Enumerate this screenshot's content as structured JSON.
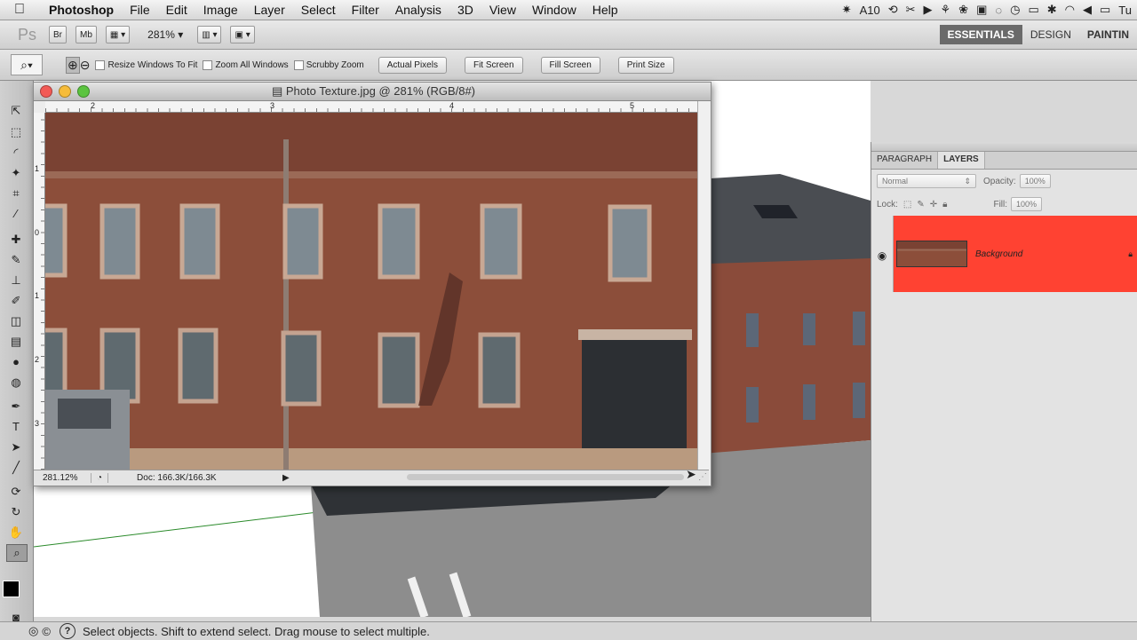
{
  "menubar": {
    "app_name": "Photoshop",
    "items": [
      "File",
      "Edit",
      "Image",
      "Layer",
      "Select",
      "Filter",
      "Analysis",
      "3D",
      "View",
      "Window",
      "Help"
    ],
    "tray_text": "10",
    "tray_end": "Tu"
  },
  "appbar": {
    "logo": "Ps",
    "bridge": "Br",
    "minibridge": "Mb",
    "zoom": "281%",
    "workspaces": [
      "ESSENTIALS",
      "DESIGN",
      "PAINTIN"
    ],
    "active_workspace": "ESSENTIALS"
  },
  "options": {
    "resize_windows": "Resize Windows To Fit",
    "zoom_all": "Zoom All Windows",
    "scrubby": "Scrubby Zoom",
    "actual_pixels": "Actual Pixels",
    "fit_screen": "Fit Screen",
    "fill_screen": "Fill Screen",
    "print_size": "Print Size"
  },
  "document": {
    "title": "Photo Texture.jpg @ 281% (RGB/8#)",
    "zoom": "281.12%",
    "doc_size": "Doc: 166.3K/166.3K",
    "ruler_top": [
      "2",
      "3",
      "4",
      "5"
    ],
    "ruler_left": [
      "1",
      "0",
      "1",
      "2",
      "3"
    ]
  },
  "layers_panel": {
    "tabs": [
      "PARAGRAPH",
      "LAYERS"
    ],
    "active_tab": "LAYERS",
    "blend_mode": "Normal",
    "opacity_label": "Opacity:",
    "opacity": "100%",
    "lock_label": "Lock:",
    "fill_label": "Fill:",
    "fill": "100%",
    "layer_name": "Background",
    "layer_color": "#ff4232"
  },
  "statusbar": {
    "message": "Select objects. Shift to extend select. Drag mouse to select multiple."
  }
}
